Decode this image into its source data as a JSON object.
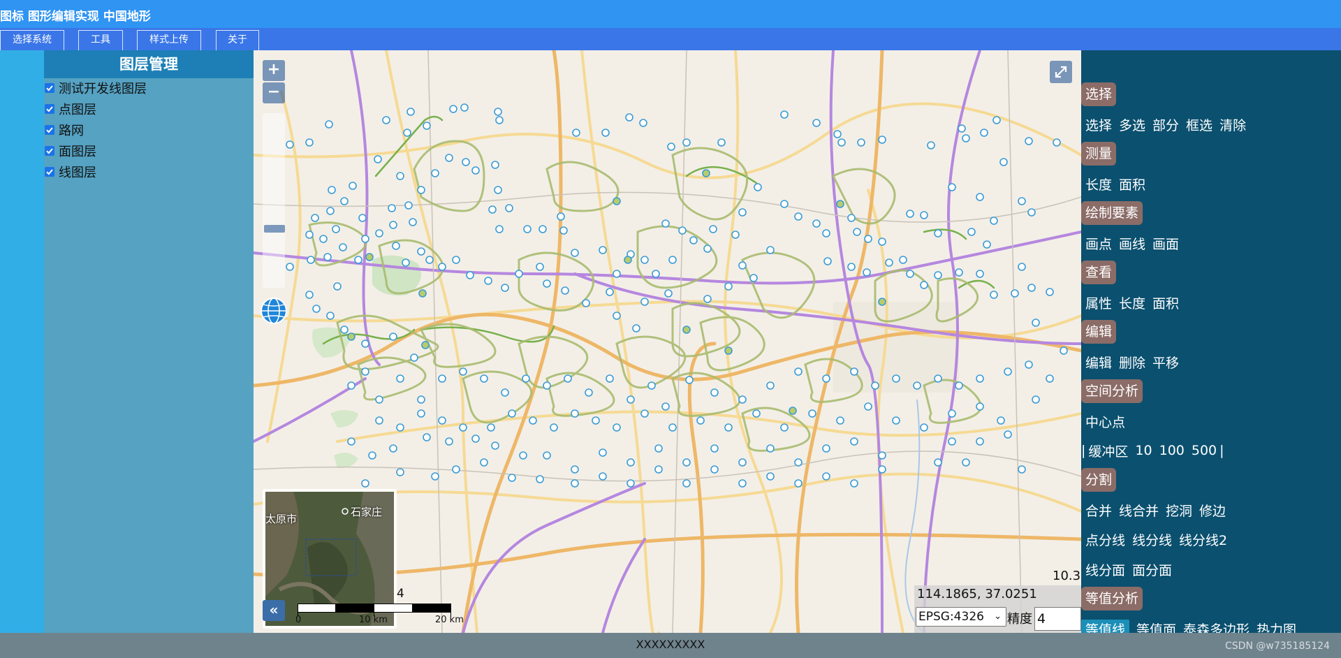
{
  "app": {
    "title": "图标 图形编辑实现 中国地形"
  },
  "menu": {
    "items": [
      "选择系统",
      "工具",
      "样式上传",
      "关于"
    ]
  },
  "layer_panel": {
    "title": "图层管理",
    "layers": [
      {
        "label": "测试开发线图层",
        "checked": true
      },
      {
        "label": "点图层",
        "checked": true
      },
      {
        "label": "路网",
        "checked": true
      },
      {
        "label": "面图层",
        "checked": true
      },
      {
        "label": "线图层",
        "checked": true
      }
    ]
  },
  "map": {
    "zoom_in": "+",
    "zoom_out": "−",
    "zoom_level_overview": "4",
    "zoom_level_view": "10.3",
    "overview": {
      "toggle": "«",
      "labels": [
        "太原市",
        "石家庄"
      ]
    },
    "scale": {
      "labels": [
        "0",
        "10 km",
        "20 km"
      ]
    },
    "coordinates": "114.1865, 37.0251",
    "projection": "EPSG:4326",
    "precision_label": "精度",
    "precision_value": "4",
    "colors": {
      "point": "#3a9bd5",
      "buffer": "#9bb15d",
      "road_major": "#f0c46c",
      "road_purple": "#b07ad6"
    }
  },
  "tools": {
    "select": {
      "title": "选择",
      "items": [
        "选择",
        "多选",
        "部分",
        "框选",
        "清除"
      ]
    },
    "measure": {
      "title": "测量",
      "items": [
        "长度",
        "面积"
      ]
    },
    "draw": {
      "title": "绘制要素",
      "items": [
        "画点",
        "画线",
        "画面"
      ]
    },
    "view": {
      "title": "查看",
      "items": [
        "属性",
        "长度",
        "面积"
      ]
    },
    "edit": {
      "title": "编辑",
      "items": [
        "编辑",
        "删除",
        "平移"
      ]
    },
    "spatial": {
      "title": "空间分析",
      "center": "中心点",
      "buffer": {
        "open": "|",
        "label": "缓冲区",
        "values": [
          "10",
          "100",
          "500"
        ],
        "close": "|"
      }
    },
    "split": {
      "title": "分割",
      "row1": [
        "合并",
        "线合并",
        "挖洞",
        "修边"
      ],
      "row2": [
        "点分线",
        "线分线",
        "线分线2"
      ],
      "row3": [
        "线分面",
        "面分面"
      ]
    },
    "contour": {
      "title": "等值分析",
      "items": [
        "等值线",
        "等值面",
        "泰森多边形",
        "热力图"
      ]
    }
  },
  "footer": {
    "text": "XXXXXXXXX",
    "watermark": "CSDN @w735185124"
  }
}
